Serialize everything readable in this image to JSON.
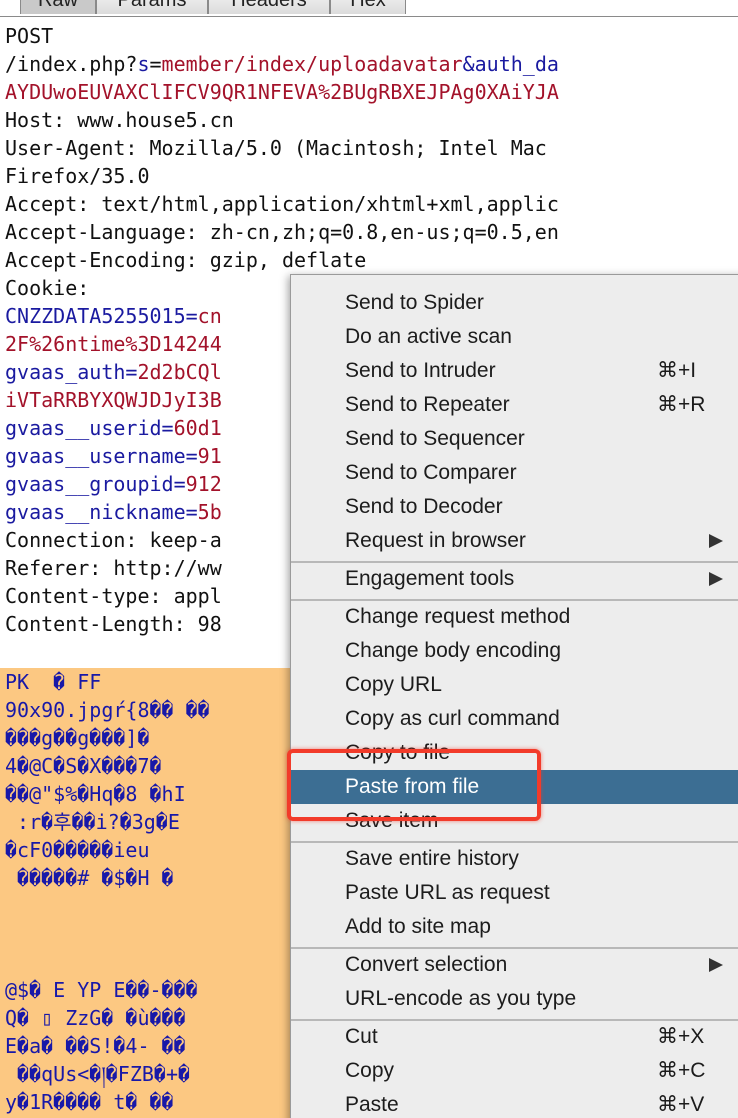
{
  "tabs": [
    "Raw",
    "Params",
    "Headers",
    "Hex"
  ],
  "request": {
    "method": "POST",
    "path_prefix": "/index.php?",
    "param1_key": "s",
    "param1_value": "member/index/uploadavatar",
    "param2_key": "&auth_da",
    "auth_cont": "AYDUwoEUVAXClIFCV9QR1NFEVA%2BUgRBXEJPAg0XAiYJA",
    "host": "Host: www.house5.cn",
    "user_agent": "User-Agent: Mozilla/5.0 (Macintosh; Intel Mac",
    "firefox": "Firefox/35.0",
    "accept": "Accept: text/html,application/xhtml+xml,applic",
    "accept_language": "Accept-Language: zh-cn,zh;q=0.8,en-us;q=0.5,en",
    "accept_encoding": "Accept-Encoding: gzip, deflate",
    "cookie_label": "Cookie:",
    "cookies": [
      {
        "key": "CNZZDATA5255015=",
        "value": "cn"
      },
      {
        "key": "",
        "value": "2F%26ntime%3D14244"
      },
      {
        "key": "gvaas_auth=",
        "value": "2d2bCQl"
      },
      {
        "key": "",
        "value": "iVTaRRBYXQWJDJyI3B"
      },
      {
        "key": "gvaas__userid=",
        "value": "60d1"
      },
      {
        "key": "gvaas__username=",
        "value": "91"
      },
      {
        "key": "gvaas__groupid=",
        "value": "912"
      },
      {
        "key": "gvaas__nickname=",
        "value": "5b"
      }
    ],
    "connection": "Connection: keep-a",
    "referer": "Referer: http://ww",
    "content_type": "Content-type: appl",
    "content_length": "Content-Length: 98"
  },
  "body_lines": [
    "PK  � FF",
    "90x90.jpgŕ{8�� ��",
    "���g��g���]�",
    "4�@C�S�X���7�",
    "��@\"$%�Hq�8 �hI",
    " :r�후��i?�3g�E",
    "�cF0�����ieu",
    " �����# �$�H �",
    "",
    "",
    "@$� E YP E��-���",
    "Q� ▯ ZzG� �ù���",
    "E�a� ��S!�4- ��",
    " ��qUs<�།�FZB�+�",
    "y�1R���� t� ��"
  ],
  "menu": {
    "items": [
      {
        "label": "Send to Spider",
        "shortcut": ""
      },
      {
        "label": "Do an active scan",
        "shortcut": ""
      },
      {
        "label": "Send to Intruder",
        "shortcut": "⌘+I"
      },
      {
        "label": "Send to Repeater",
        "shortcut": "⌘+R"
      },
      {
        "label": "Send to Sequencer",
        "shortcut": ""
      },
      {
        "label": "Send to Comparer",
        "shortcut": ""
      },
      {
        "label": "Send to Decoder",
        "shortcut": ""
      },
      {
        "label": "Request in browser",
        "shortcut": ""
      },
      {
        "label": "Engagement tools",
        "shortcut": ""
      },
      {
        "label": "Change request method",
        "shortcut": ""
      },
      {
        "label": "Change body encoding",
        "shortcut": ""
      },
      {
        "label": "Copy URL",
        "shortcut": ""
      },
      {
        "label": "Copy as curl command",
        "shortcut": ""
      },
      {
        "label": "Copy to file",
        "shortcut": ""
      },
      {
        "label": "Paste from file",
        "shortcut": ""
      },
      {
        "label": "Save item",
        "shortcut": ""
      },
      {
        "label": "Save entire history",
        "shortcut": ""
      },
      {
        "label": "Paste URL as request",
        "shortcut": ""
      },
      {
        "label": "Add to site map",
        "shortcut": ""
      },
      {
        "label": "Convert selection",
        "shortcut": ""
      },
      {
        "label": "URL-encode as you type",
        "shortcut": ""
      },
      {
        "label": "Cut",
        "shortcut": "⌘+X"
      },
      {
        "label": "Copy",
        "shortcut": "⌘+C"
      },
      {
        "label": "Paste",
        "shortcut": "⌘+V"
      }
    ],
    "highlighted": "Paste from file",
    "submenu_items": [
      "Request in browser",
      "Engagement tools",
      "Convert selection"
    ]
  },
  "colors": {
    "highlight": "#3c6e93",
    "callout": "#f23b2a",
    "body_background": "#fcc882",
    "header_key": "#1a1aa0",
    "header_value": "#a3122a"
  }
}
